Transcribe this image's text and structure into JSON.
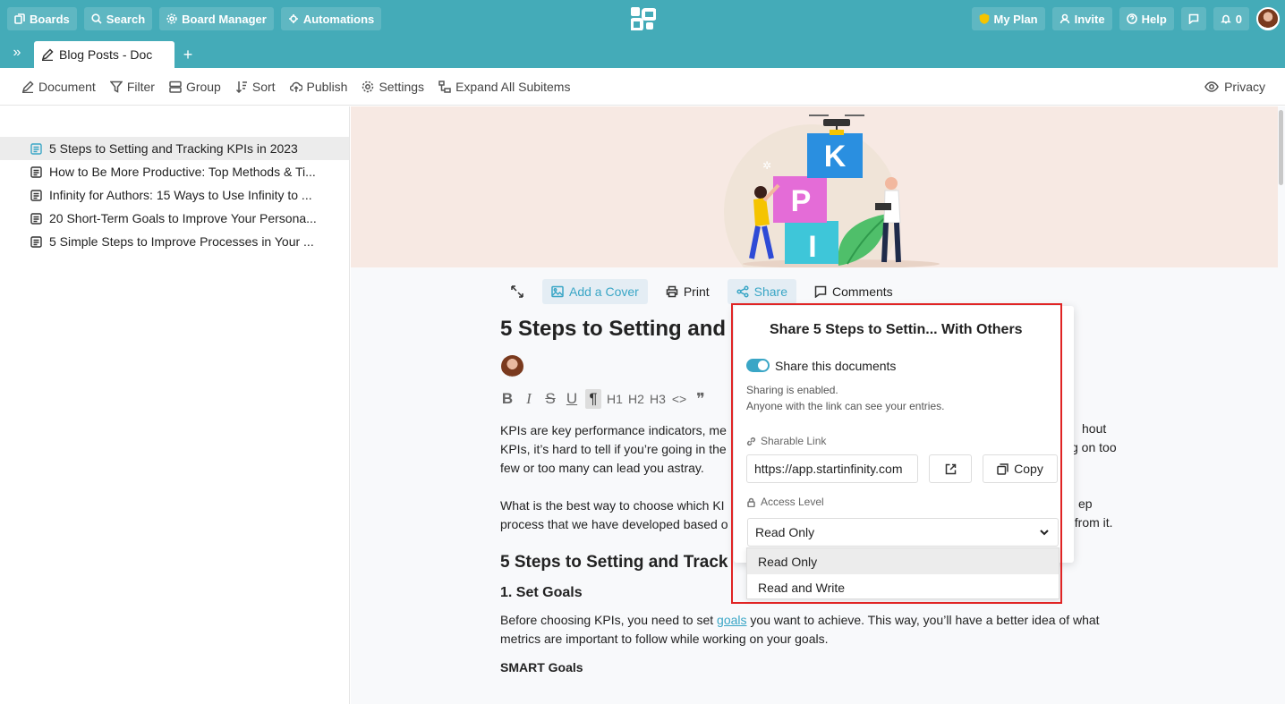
{
  "topbar": {
    "boards": "Boards",
    "search": "Search",
    "board_manager": "Board Manager",
    "automations": "Automations",
    "my_plan": "My Plan",
    "invite": "Invite",
    "help": "Help",
    "notifications_count": "0"
  },
  "tabs": {
    "active_tab": "Blog Posts - Doc",
    "add": "+"
  },
  "toolbar": {
    "document": "Document",
    "filter": "Filter",
    "group": "Group",
    "sort": "Sort",
    "publish": "Publish",
    "settings": "Settings",
    "expand_all": "Expand All Subitems",
    "privacy": "Privacy"
  },
  "sidebar": {
    "items": [
      {
        "label": "5 Steps to Setting and Tracking KPIs in 2023"
      },
      {
        "label": "How to Be More Productive: Top Methods & Ti..."
      },
      {
        "label": "Infinity for Authors: 15 Ways to Use Infinity to ..."
      },
      {
        "label": "20 Short-Term Goals to Improve Your Persona..."
      },
      {
        "label": "5 Simple Steps to Improve Processes in Your ..."
      }
    ]
  },
  "doc": {
    "actions": {
      "add_cover": "Add a Cover",
      "print": "Print",
      "share": "Share",
      "comments": "Comments"
    },
    "title": "5 Steps to Setting and",
    "format": {
      "bold": "B",
      "italic": "I",
      "strike": "S",
      "underline": "U",
      "paragraph": "¶",
      "h1": "H1",
      "h2": "H2",
      "h3": "H3",
      "code": "<>",
      "quote": "❞"
    },
    "para1_line1": "KPIs are key performance indicators, me",
    "para1_line2": "KPIs, it’s hard to tell if you’re going in the",
    "para1_line3": "few or too many can lead you astray.",
    "para1_right1": "hout",
    "para1_right2": "g on too",
    "para2_line1": "What is the best way to choose which KI",
    "para2_line2": "process that we have developed based o",
    "para2_right1": "ep",
    "para2_right2": "t from it.",
    "heading": "5 Steps to Setting and Track",
    "subheading": "1. Set Goals",
    "para3_pre": "Before choosing KPIs, you need to set ",
    "para3_link": "goals",
    "para3_post": " you want to achieve. This way, you’ll have a better idea of what",
    "para3_line2": "metrics are important to follow while working on your goals.",
    "smart": "SMART Goals"
  },
  "share_popup": {
    "title": "Share 5 Steps to Settin...  With Others",
    "toggle_label": "Share this documents",
    "toggle_on": true,
    "status_line1": "Sharing is enabled.",
    "status_line2": "Anyone with the link can see your entries.",
    "link_label": "Sharable Link",
    "link_value": "https://app.startinfinity.com",
    "copy": "Copy",
    "access_label": "Access Level",
    "access_selected": "Read Only",
    "access_options": [
      "Read Only",
      "Read and Write"
    ]
  },
  "colors": {
    "brand": "#44abb8",
    "accent": "#3aa6c6",
    "highlight": "#e02424"
  }
}
